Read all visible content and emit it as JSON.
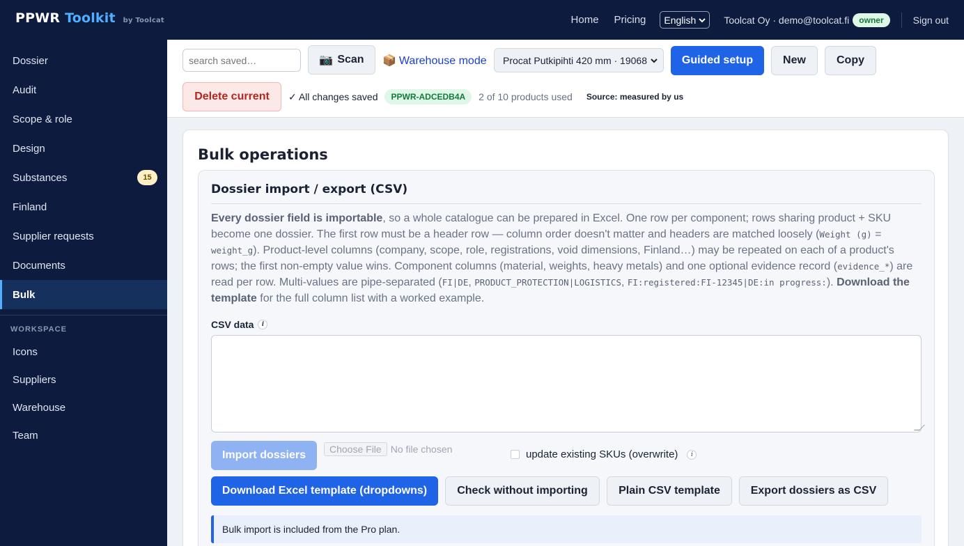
{
  "brand": {
    "name_part1": "PPWR",
    "name_part2": "Toolkit",
    "by_line": "by Toolcat"
  },
  "topnav": {
    "home": "Home",
    "pricing": "Pricing",
    "language": "English",
    "account": "Toolcat Oy · demo@toolcat.fi",
    "role": "owner",
    "sign_out": "Sign out"
  },
  "sidebar": {
    "items": [
      {
        "label": "Dossier"
      },
      {
        "label": "Audit"
      },
      {
        "label": "Scope & role"
      },
      {
        "label": "Design"
      },
      {
        "label": "Substances",
        "badge": "15"
      },
      {
        "label": "Finland"
      },
      {
        "label": "Supplier requests"
      },
      {
        "label": "Documents"
      },
      {
        "label": "Bulk"
      }
    ],
    "active": "Bulk",
    "workspace_heading": "WORKSPACE",
    "workspace_items": [
      {
        "label": "Icons"
      },
      {
        "label": "Suppliers"
      },
      {
        "label": "Warehouse"
      },
      {
        "label": "Team"
      }
    ]
  },
  "toolbar": {
    "search_placeholder": "search saved…",
    "scan_label": "Scan",
    "scan_icon": "camera-icon",
    "warehouse_label": "Warehouse mode",
    "warehouse_icon": "package-icon",
    "product_selected": "Procat Putkipihti 420 mm · 19068 ·",
    "guided_setup": "Guided setup",
    "new_label": "New",
    "copy_label": "Copy",
    "delete_label": "Delete current",
    "saved_status": "✓ All changes saved",
    "product_code": "PPWR-ADCEDB4A",
    "usage": "2 of 10 products used",
    "source": "Source: measured by us"
  },
  "main": {
    "title": "Bulk operations",
    "panel_title": "Dossier import / export (CSV)",
    "desc": {
      "lead": "Every dossier field is importable",
      "t1": ", so a whole catalogue can be prepared in Excel. One row per component; rows sharing product + SKU become one dossier. The first row must be a header row — column order doesn't matter and headers are matched loosely (",
      "c1": "Weight (g)",
      "t2": " = ",
      "c2": "weight_g",
      "t3": "). Product-level columns (company, scope, role, registrations, void dimensions, Finland…) may be repeated on each of a product's rows; the first non-empty value wins. Component columns (material, weights, heavy metals) and one optional evidence record (",
      "c3": "evidence_*",
      "t4": ") are read per row. Multi-values are pipe-separated (",
      "c4": "FI|DE",
      "t5": ", ",
      "c5": "PRODUCT_PROTECTION|LOGISTICS",
      "t6": ", ",
      "c6": "FI:registered:FI-12345|DE:in progress:",
      "t7": "). ",
      "b2": "Download the template",
      "t8": " for the full column list with a worked example."
    },
    "csv_label": "CSV data",
    "csv_value": "",
    "import_label": "Import dossiers",
    "choose_file": "Choose File",
    "no_file": "No file chosen",
    "overwrite_label": "update existing SKUs (overwrite)",
    "download_excel": "Download Excel template (dropdowns)",
    "check_label": "Check without importing",
    "plain_csv": "Plain CSV template",
    "export_label": "Export dossiers as CSV",
    "notice": "Bulk import is included from the Pro plan."
  },
  "colors": {
    "nav_bg": "#0d1b3e",
    "accent": "#1f63e6",
    "brand_accent": "#4fb0ff",
    "success_bg": "#dff7e7",
    "danger": "#b3261e"
  }
}
